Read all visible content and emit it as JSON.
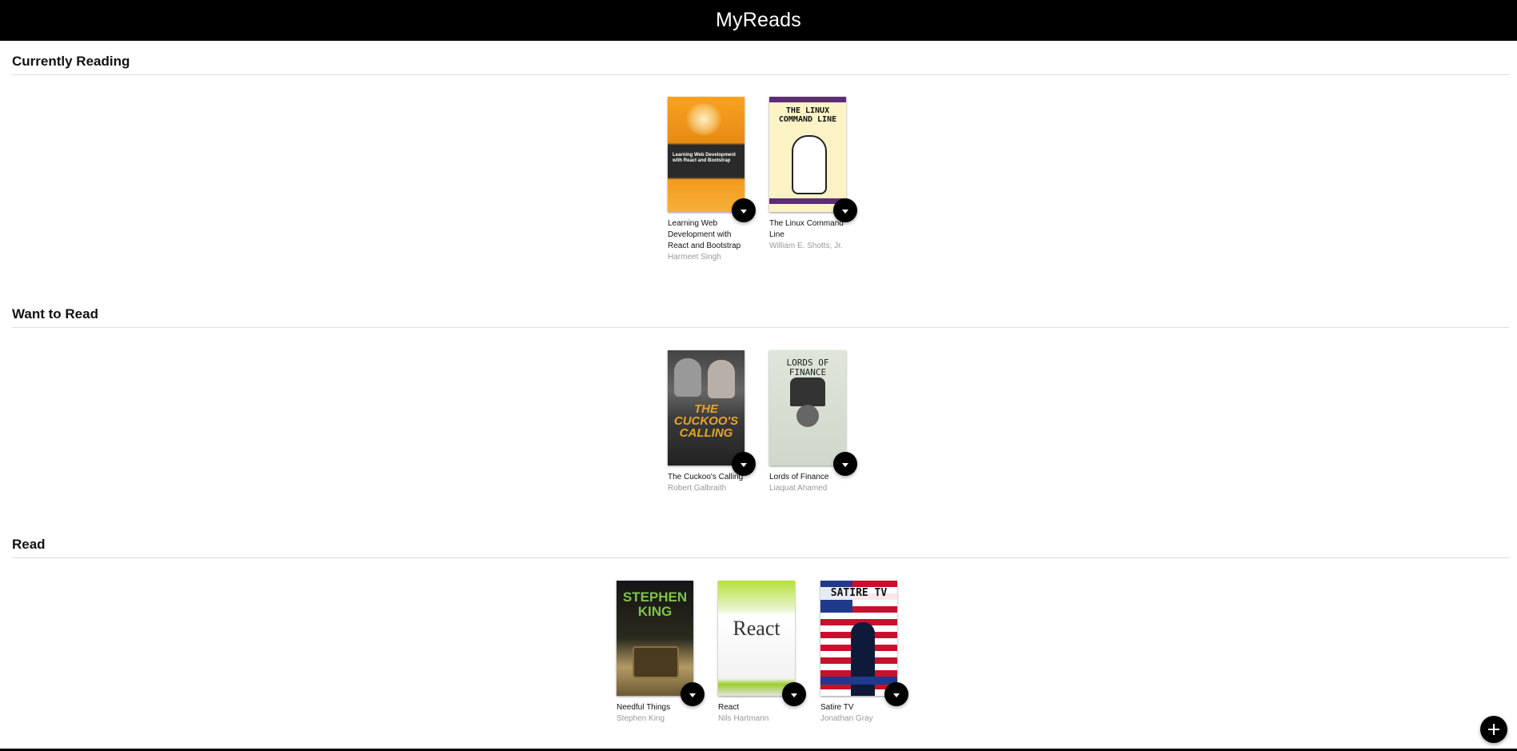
{
  "header": {
    "title": "MyReads"
  },
  "shelves": {
    "currently_reading": {
      "title": "Currently Reading",
      "books": [
        {
          "title": "Learning Web Development with React and Bootstrap",
          "authors": "Harmeet Singh",
          "cover_text": "Learning Web Development with React and Bootstrap"
        },
        {
          "title": "The Linux Command Line",
          "authors": "William E. Shotts, Jr.",
          "cover_text": "THE LINUX COMMAND LINE"
        }
      ]
    },
    "want_to_read": {
      "title": "Want to Read",
      "books": [
        {
          "title": "The Cuckoo's Calling",
          "authors": "Robert Galbraith",
          "cover_text": "THE CUCKOO'S CALLING"
        },
        {
          "title": "Lords of Finance",
          "authors": "Liaquat Ahamed",
          "cover_text": "LORDS OF FINANCE"
        }
      ]
    },
    "read": {
      "title": "Read",
      "books": [
        {
          "title": "Needful Things",
          "authors": "Stephen King",
          "cover_text": "STEPHEN KING"
        },
        {
          "title": "React",
          "authors": "Nils Hartmann",
          "cover_text": "React"
        },
        {
          "title": "Satire TV",
          "authors": "Jonathan Gray",
          "cover_text": "SATIRE TV"
        }
      ]
    }
  },
  "icons": {
    "shelf_changer": "chevron-down-icon",
    "add_book": "plus-icon"
  },
  "colors": {
    "header_bg": "#000000",
    "header_text": "#ffffff",
    "author_text": "#999999"
  }
}
